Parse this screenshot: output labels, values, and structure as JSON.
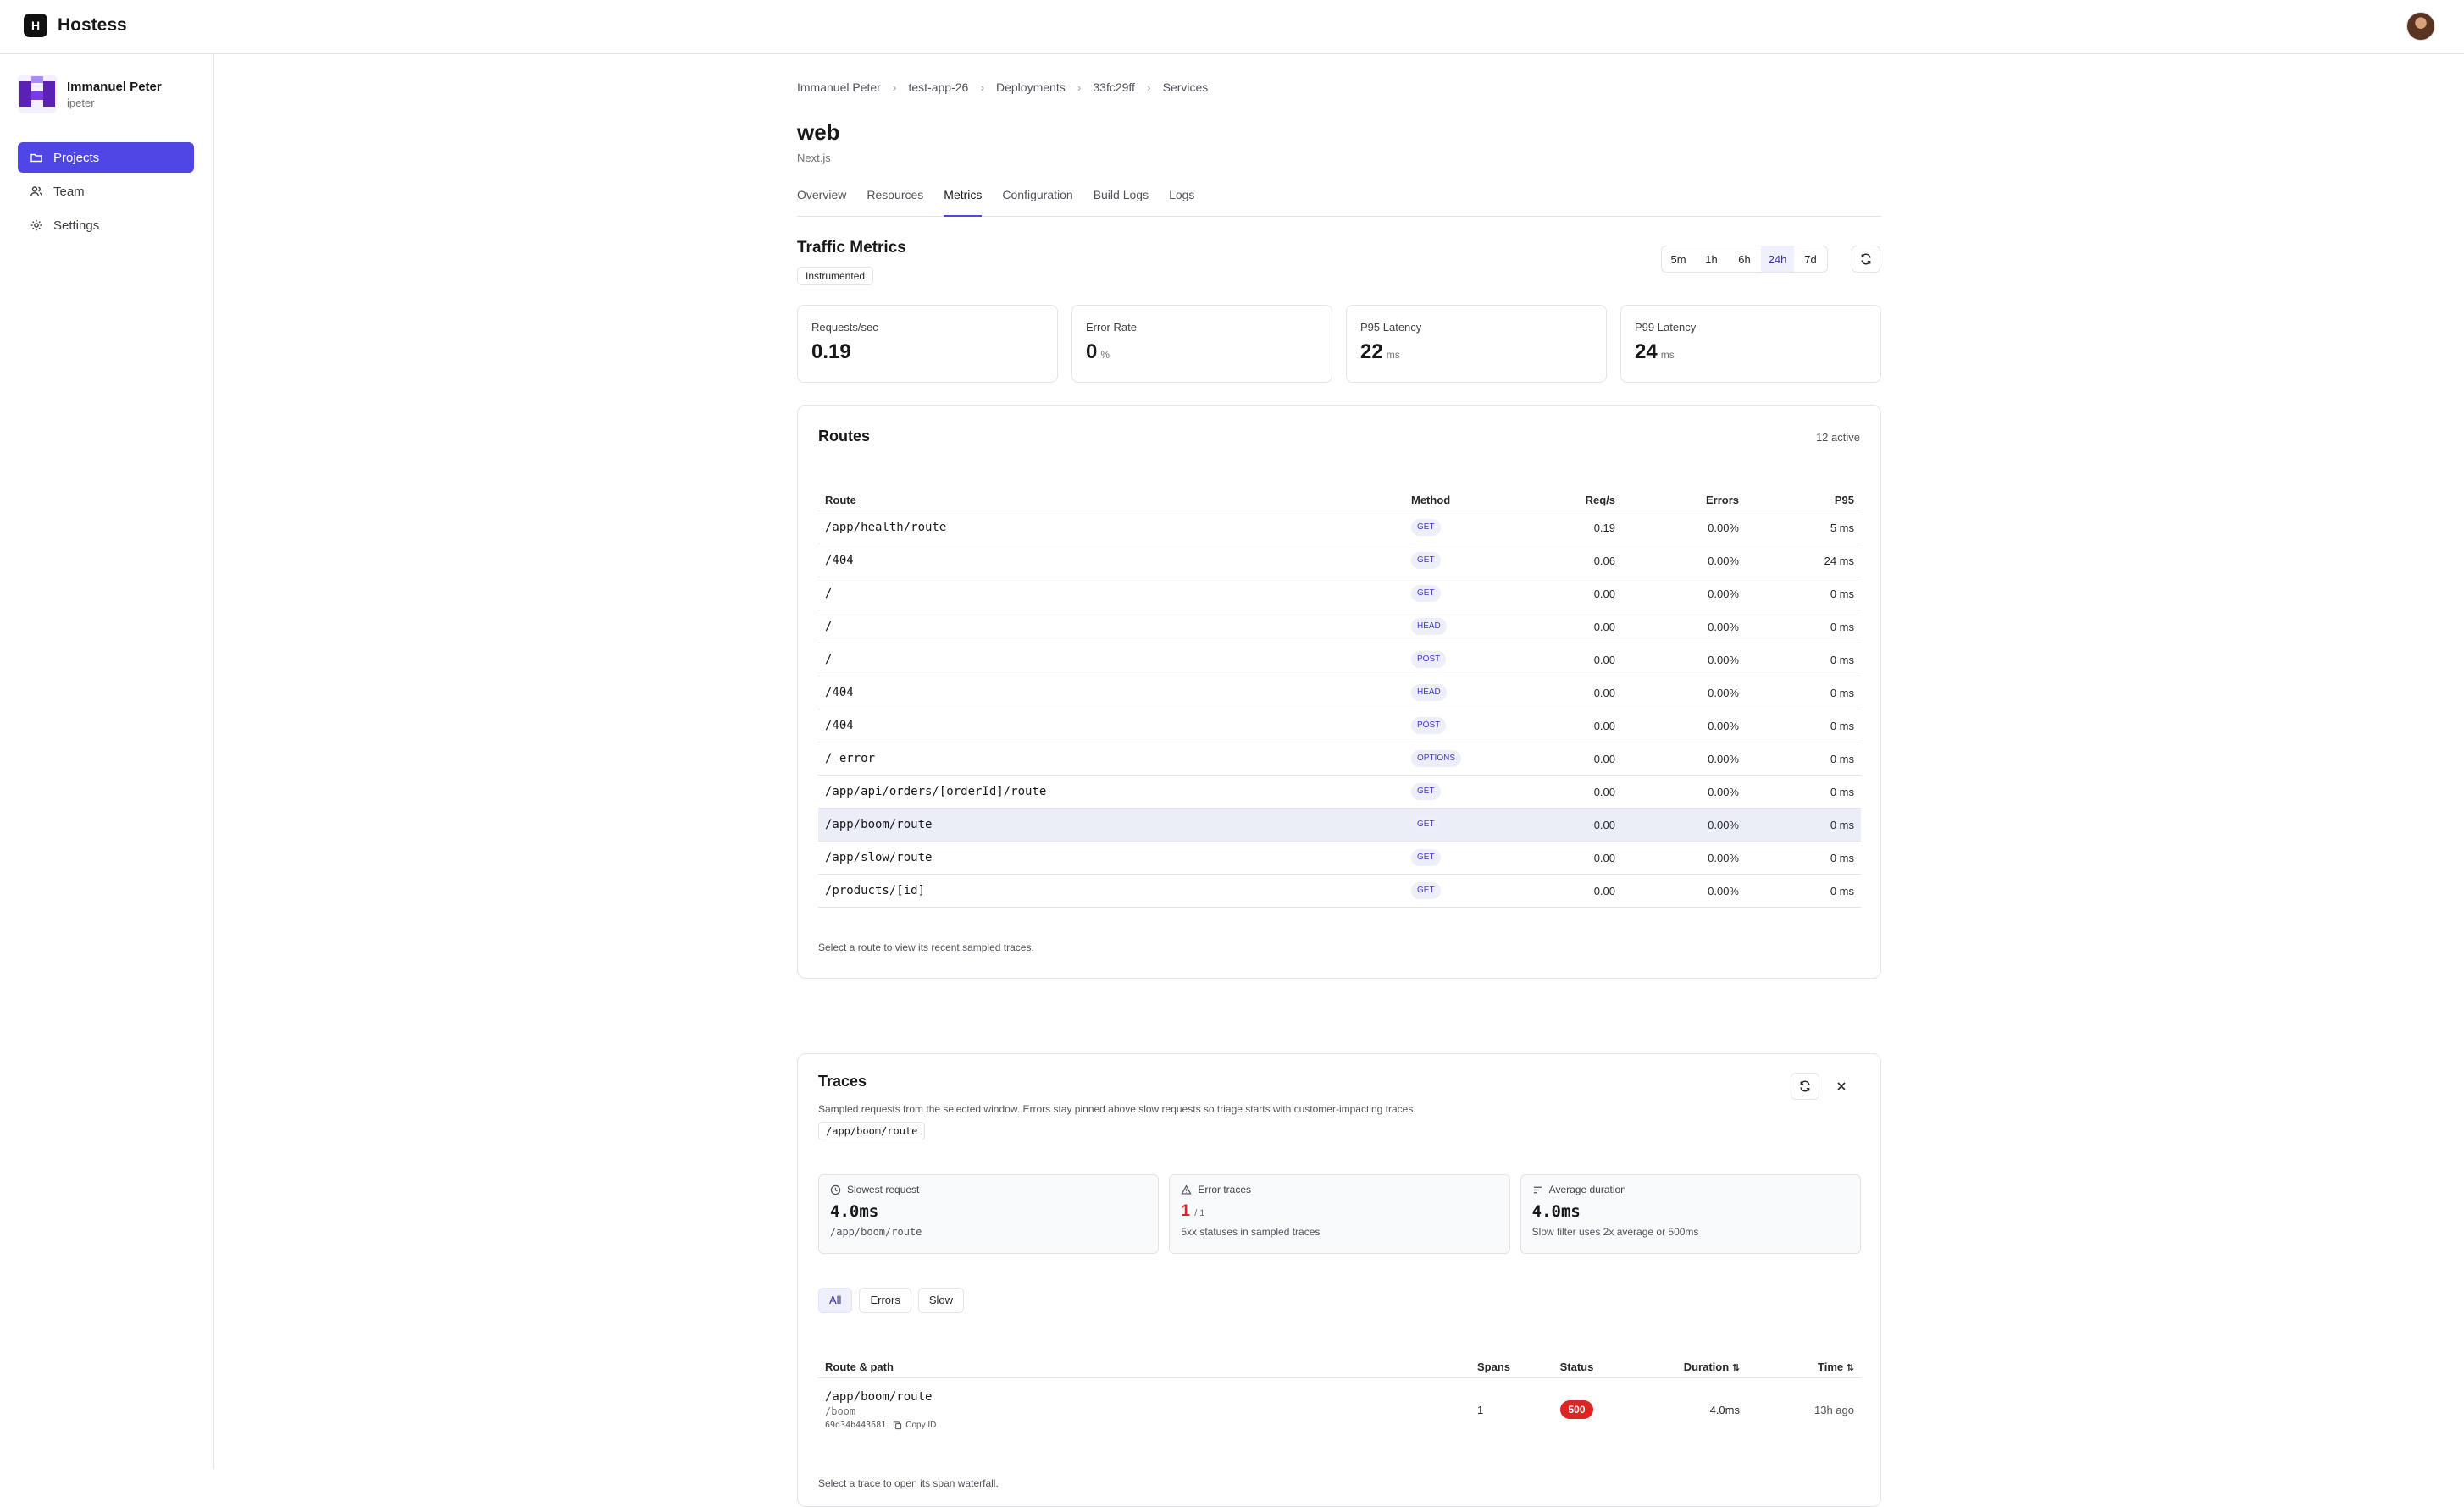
{
  "app": {
    "name": "Hostess",
    "logo_letter": "H"
  },
  "user": {
    "name": "Immanuel Peter",
    "handle": "ipeter"
  },
  "nav": [
    {
      "label": "Projects",
      "icon": "folder-icon",
      "active": true
    },
    {
      "label": "Team",
      "icon": "users-icon",
      "active": false
    },
    {
      "label": "Settings",
      "icon": "gear-icon",
      "active": false
    }
  ],
  "breadcrumb": [
    "Immanuel Peter",
    "test-app-26",
    "Deployments",
    "33fc29ff",
    "Services"
  ],
  "page": {
    "title": "web",
    "subtitle": "Next.js"
  },
  "tabs": [
    {
      "label": "Overview",
      "active": false
    },
    {
      "label": "Resources",
      "active": false
    },
    {
      "label": "Metrics",
      "active": true
    },
    {
      "label": "Configuration",
      "active": false
    },
    {
      "label": "Build Logs",
      "active": false
    },
    {
      "label": "Logs",
      "active": false
    }
  ],
  "traffic": {
    "title": "Traffic Metrics",
    "badge": "Instrumented",
    "ranges": [
      "5m",
      "1h",
      "6h",
      "24h",
      "7d"
    ],
    "selected_range": "24h"
  },
  "stats": [
    {
      "label": "Requests/sec",
      "value": "0.19",
      "unit": ""
    },
    {
      "label": "Error Rate",
      "value": "0",
      "unit": "%"
    },
    {
      "label": "P95 Latency",
      "value": "22",
      "unit": "ms"
    },
    {
      "label": "P99 Latency",
      "value": "24",
      "unit": "ms"
    }
  ],
  "routes": {
    "title": "Routes",
    "active_count": "12 active",
    "columns": [
      "Route",
      "Method",
      "Req/s",
      "Errors",
      "P95"
    ],
    "rows": [
      {
        "route": "/app/health/route",
        "method": "GET",
        "req": "0.19",
        "errors": "0.00%",
        "p95": "5 ms",
        "selected": false
      },
      {
        "route": "/404",
        "method": "GET",
        "req": "0.06",
        "errors": "0.00%",
        "p95": "24 ms",
        "selected": false
      },
      {
        "route": "/",
        "method": "GET",
        "req": "0.00",
        "errors": "0.00%",
        "p95": "0 ms",
        "selected": false
      },
      {
        "route": "/",
        "method": "HEAD",
        "req": "0.00",
        "errors": "0.00%",
        "p95": "0 ms",
        "selected": false
      },
      {
        "route": "/",
        "method": "POST",
        "req": "0.00",
        "errors": "0.00%",
        "p95": "0 ms",
        "selected": false
      },
      {
        "route": "/404",
        "method": "HEAD",
        "req": "0.00",
        "errors": "0.00%",
        "p95": "0 ms",
        "selected": false
      },
      {
        "route": "/404",
        "method": "POST",
        "req": "0.00",
        "errors": "0.00%",
        "p95": "0 ms",
        "selected": false
      },
      {
        "route": "/_error",
        "method": "OPTIONS",
        "req": "0.00",
        "errors": "0.00%",
        "p95": "0 ms",
        "selected": false
      },
      {
        "route": "/app/api/orders/[orderId]/route",
        "method": "GET",
        "req": "0.00",
        "errors": "0.00%",
        "p95": "0 ms",
        "selected": false
      },
      {
        "route": "/app/boom/route",
        "method": "GET",
        "req": "0.00",
        "errors": "0.00%",
        "p95": "0 ms",
        "selected": true
      },
      {
        "route": "/app/slow/route",
        "method": "GET",
        "req": "0.00",
        "errors": "0.00%",
        "p95": "0 ms",
        "selected": false
      },
      {
        "route": "/products/[id]",
        "method": "GET",
        "req": "0.00",
        "errors": "0.00%",
        "p95": "0 ms",
        "selected": false
      }
    ],
    "footer": "Select a route to view its recent sampled traces."
  },
  "traces": {
    "title": "Traces",
    "description": "Sampled requests from the selected window. Errors stay pinned above slow requests so triage starts with customer-impacting traces.",
    "selected_route": "/app/boom/route",
    "summary": [
      {
        "label": "Slowest request",
        "icon": "clock-icon",
        "value": "4.0ms",
        "of": "",
        "sub": "/app/boom/route",
        "error": false
      },
      {
        "label": "Error traces",
        "icon": "warning-icon",
        "value": "1",
        "of": "/ 1",
        "sub": "5xx statuses in sampled traces",
        "error": true
      },
      {
        "label": "Average duration",
        "icon": "sort-lines-icon",
        "value": "4.0ms",
        "of": "",
        "sub": "Slow filter uses 2x average or 500ms",
        "error": false
      }
    ],
    "filters": [
      "All",
      "Errors",
      "Slow"
    ],
    "active_filter": "All",
    "columns": [
      "Route & path",
      "Spans",
      "Status",
      "Duration",
      "Time"
    ],
    "rows": [
      {
        "route": "/app/boom/route",
        "path": "/boom",
        "trace_id": "69d34b443681",
        "copy_label": "Copy ID",
        "spans": "1",
        "status": "500",
        "duration": "4.0ms",
        "time": "13h ago"
      }
    ],
    "footer": "Select a trace to open its span waterfall."
  },
  "colors": {
    "accent": "#4f46e5",
    "error": "#dc2626",
    "border": "#e4e4e7"
  }
}
